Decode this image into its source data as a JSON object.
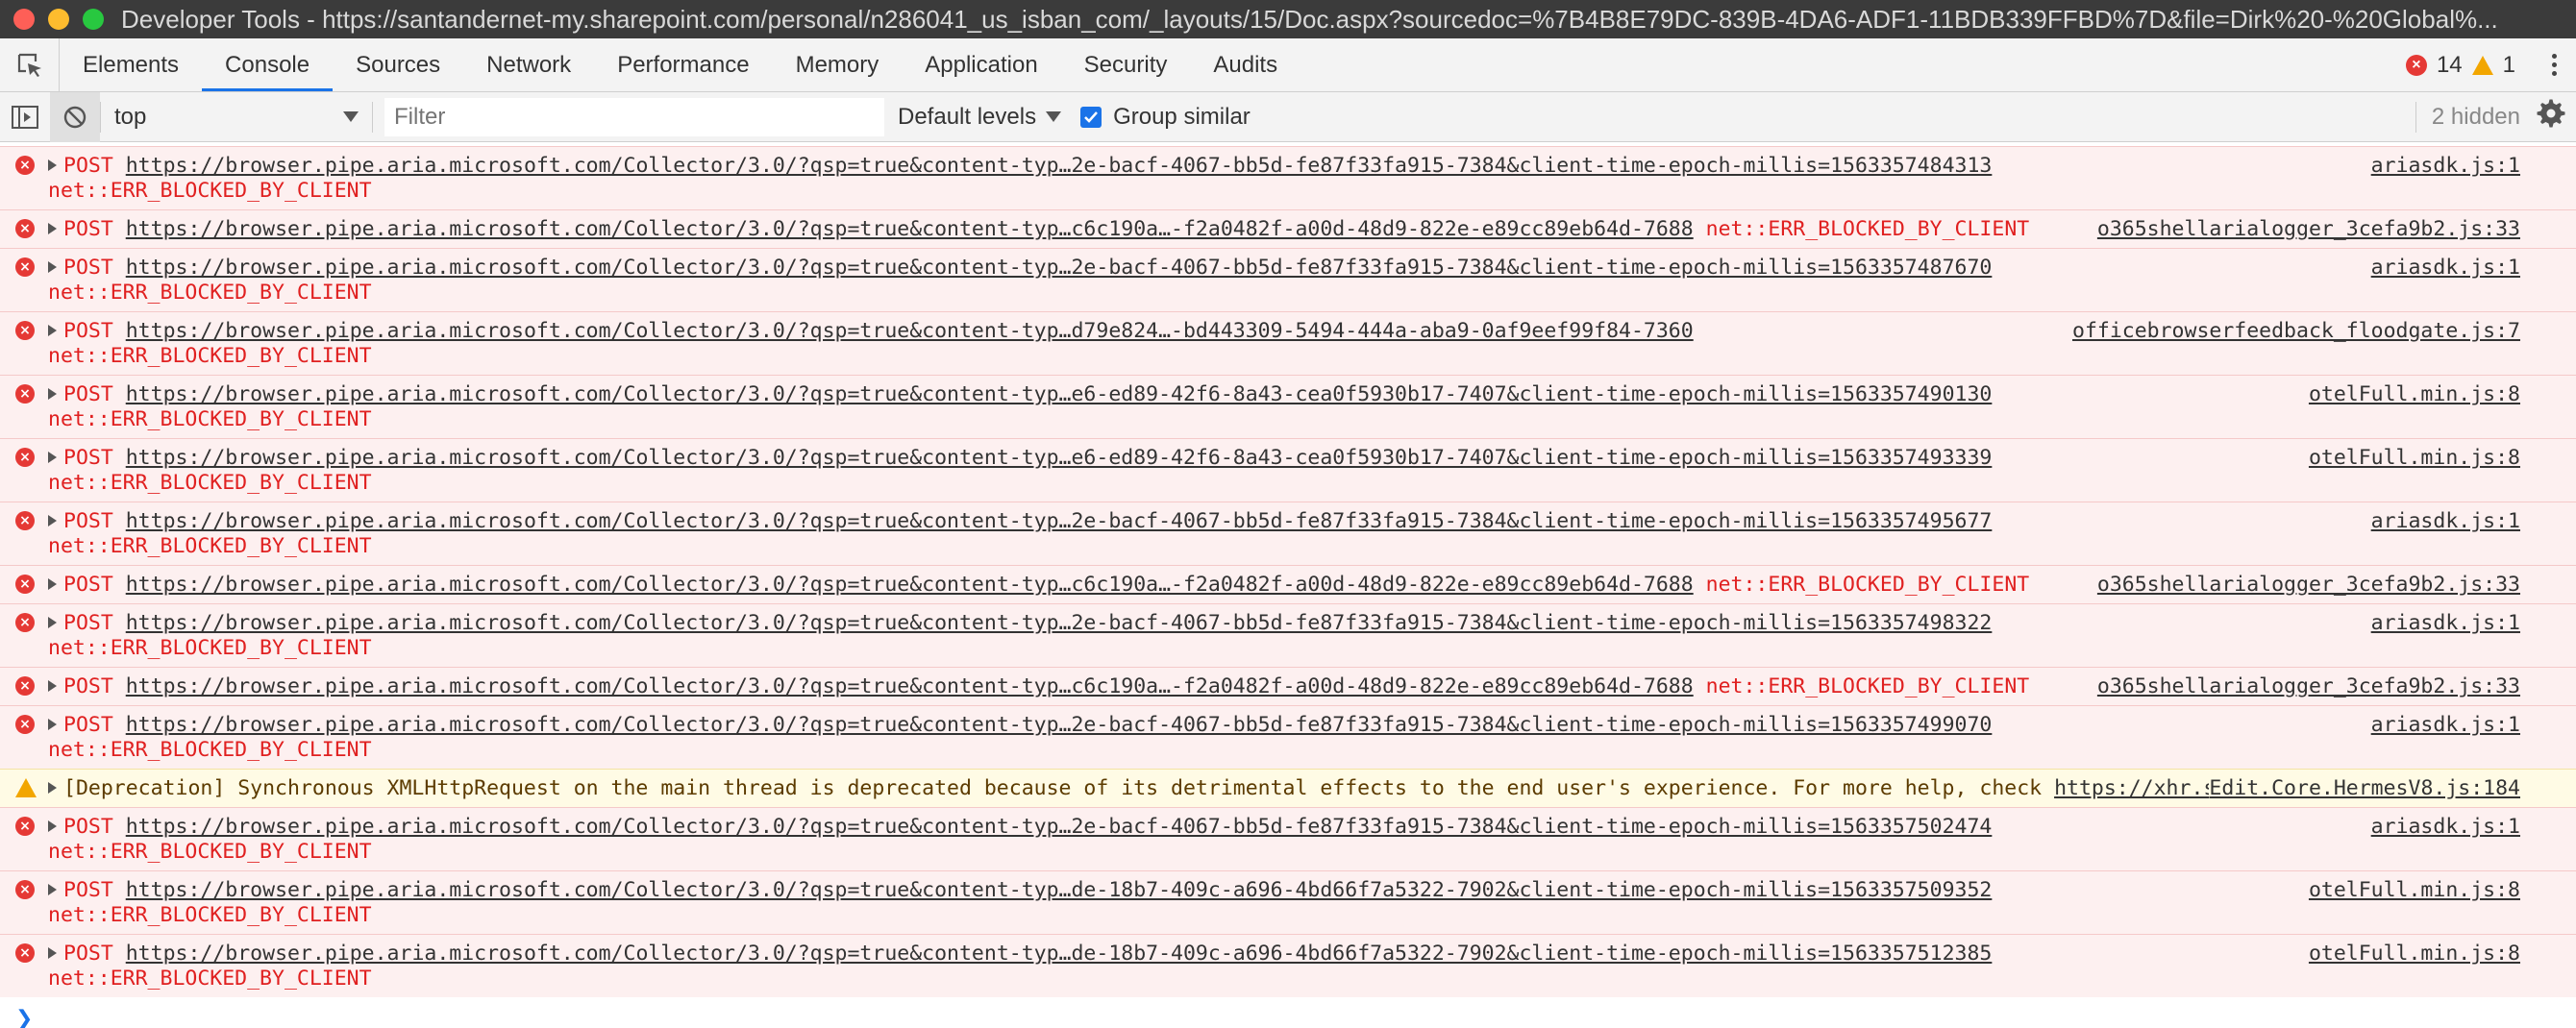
{
  "window": {
    "title": "Developer Tools - https://santandernet-my.sharepoint.com/personal/n286041_us_isban_com/_layouts/15/Doc.aspx?sourcedoc=%7B4B8E79DC-839B-4DA6-ADF1-11BDB339FFBD%7D&file=Dirk%20-%20Global%..."
  },
  "tabs": [
    "Elements",
    "Console",
    "Sources",
    "Network",
    "Performance",
    "Memory",
    "Application",
    "Security",
    "Audits"
  ],
  "active_tab": "Console",
  "status": {
    "errors": "14",
    "warnings": "1"
  },
  "toolbar": {
    "context": "top",
    "filter_placeholder": "Filter",
    "levels": "Default levels",
    "group_similar": "Group similar",
    "hidden": "2 hidden"
  },
  "messages": [
    {
      "type": "error",
      "method": "POST",
      "url": "https://browser.pipe.aria.microsoft.com/Collector/3.0/?qsp=true&content-typ…2e-bacf-4067-bb5d-fe87f33fa915-7384&client-time-epoch-millis=1563357484313",
      "inline": "",
      "error": "net::ERR_BLOCKED_BY_CLIENT",
      "source": "ariasdk.js:1"
    },
    {
      "type": "error",
      "method": "POST",
      "url": "https://browser.pipe.aria.microsoft.com/Collector/3.0/?qsp=true&content-typ…c6c190a…-f2a0482f-a00d-48d9-822e-e89cc89eb64d-7688",
      "inline": "net::ERR_BLOCKED_BY_CLIENT",
      "error": "",
      "source": "o365shellarialogger_3cefa9b2.js:33"
    },
    {
      "type": "error",
      "method": "POST",
      "url": "https://browser.pipe.aria.microsoft.com/Collector/3.0/?qsp=true&content-typ…2e-bacf-4067-bb5d-fe87f33fa915-7384&client-time-epoch-millis=1563357487670",
      "inline": "",
      "error": "net::ERR_BLOCKED_BY_CLIENT",
      "source": "ariasdk.js:1"
    },
    {
      "type": "error",
      "method": "POST",
      "url": "https://browser.pipe.aria.microsoft.com/Collector/3.0/?qsp=true&content-typ…d79e824…-bd443309-5494-444a-aba9-0af9eef99f84-7360",
      "inline": "",
      "error": "net::ERR_BLOCKED_BY_CLIENT",
      "source": "officebrowserfeedback_floodgate.js:7"
    },
    {
      "type": "error",
      "method": "POST",
      "url": "https://browser.pipe.aria.microsoft.com/Collector/3.0/?qsp=true&content-typ…e6-ed89-42f6-8a43-cea0f5930b17-7407&client-time-epoch-millis=1563357490130",
      "inline": "",
      "error": "net::ERR_BLOCKED_BY_CLIENT",
      "source": "otelFull.min.js:8"
    },
    {
      "type": "error",
      "method": "POST",
      "url": "https://browser.pipe.aria.microsoft.com/Collector/3.0/?qsp=true&content-typ…e6-ed89-42f6-8a43-cea0f5930b17-7407&client-time-epoch-millis=1563357493339",
      "inline": "",
      "error": "net::ERR_BLOCKED_BY_CLIENT",
      "source": "otelFull.min.js:8"
    },
    {
      "type": "error",
      "method": "POST",
      "url": "https://browser.pipe.aria.microsoft.com/Collector/3.0/?qsp=true&content-typ…2e-bacf-4067-bb5d-fe87f33fa915-7384&client-time-epoch-millis=1563357495677",
      "inline": "",
      "error": "net::ERR_BLOCKED_BY_CLIENT",
      "source": "ariasdk.js:1"
    },
    {
      "type": "error",
      "method": "POST",
      "url": "https://browser.pipe.aria.microsoft.com/Collector/3.0/?qsp=true&content-typ…c6c190a…-f2a0482f-a00d-48d9-822e-e89cc89eb64d-7688",
      "inline": "net::ERR_BLOCKED_BY_CLIENT",
      "error": "",
      "source": "o365shellarialogger_3cefa9b2.js:33"
    },
    {
      "type": "error",
      "method": "POST",
      "url": "https://browser.pipe.aria.microsoft.com/Collector/3.0/?qsp=true&content-typ…2e-bacf-4067-bb5d-fe87f33fa915-7384&client-time-epoch-millis=1563357498322",
      "inline": "",
      "error": "net::ERR_BLOCKED_BY_CLIENT",
      "source": "ariasdk.js:1"
    },
    {
      "type": "error",
      "method": "POST",
      "url": "https://browser.pipe.aria.microsoft.com/Collector/3.0/?qsp=true&content-typ…c6c190a…-f2a0482f-a00d-48d9-822e-e89cc89eb64d-7688",
      "inline": "net::ERR_BLOCKED_BY_CLIENT",
      "error": "",
      "source": "o365shellarialogger_3cefa9b2.js:33"
    },
    {
      "type": "error",
      "method": "POST",
      "url": "https://browser.pipe.aria.microsoft.com/Collector/3.0/?qsp=true&content-typ…2e-bacf-4067-bb5d-fe87f33fa915-7384&client-time-epoch-millis=1563357499070",
      "inline": "",
      "error": "net::ERR_BLOCKED_BY_CLIENT",
      "source": "ariasdk.js:1"
    },
    {
      "type": "warning",
      "text": "[Deprecation] Synchronous XMLHttpRequest on the main thread is deprecated because of its detrimental effects to the end user's experience. For more help, check ",
      "link": "https://xhr.spec.whatwg.org/",
      "tail": ".",
      "source": "Edit.Core.HermesV8.js:184"
    },
    {
      "type": "error",
      "method": "POST",
      "url": "https://browser.pipe.aria.microsoft.com/Collector/3.0/?qsp=true&content-typ…2e-bacf-4067-bb5d-fe87f33fa915-7384&client-time-epoch-millis=1563357502474",
      "inline": "",
      "error": "net::ERR_BLOCKED_BY_CLIENT",
      "source": "ariasdk.js:1"
    },
    {
      "type": "error",
      "method": "POST",
      "url": "https://browser.pipe.aria.microsoft.com/Collector/3.0/?qsp=true&content-typ…de-18b7-409c-a696-4bd66f7a5322-7902&client-time-epoch-millis=1563357509352",
      "inline": "",
      "error": "net::ERR_BLOCKED_BY_CLIENT",
      "source": "otelFull.min.js:8"
    },
    {
      "type": "error",
      "method": "POST",
      "url": "https://browser.pipe.aria.microsoft.com/Collector/3.0/?qsp=true&content-typ…de-18b7-409c-a696-4bd66f7a5322-7902&client-time-epoch-millis=1563357512385",
      "inline": "",
      "error": "net::ERR_BLOCKED_BY_CLIENT",
      "source": "otelFull.min.js:8"
    }
  ],
  "colors": {
    "error_text": "#e02020",
    "error_bg": "#fdf0f0",
    "warning_bg": "#fffbe5",
    "accent": "#1a73e8"
  },
  "icons": {
    "inspect": "inspect-element-icon",
    "sidebar": "sidebar-toggle-icon",
    "clear": "clear-console-icon",
    "settings": "gear-icon",
    "menu": "kebab-menu-icon",
    "prompt": "console-prompt-icon"
  }
}
